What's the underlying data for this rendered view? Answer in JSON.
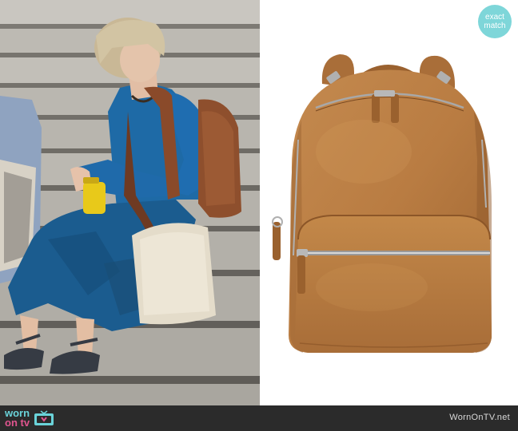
{
  "badge": {
    "line1": "exact",
    "line2": "match"
  },
  "footer": {
    "logo_top": "worn",
    "logo_bottom": "on tv",
    "site": "WornOnTV.net"
  },
  "watermark": "wornontv.net"
}
